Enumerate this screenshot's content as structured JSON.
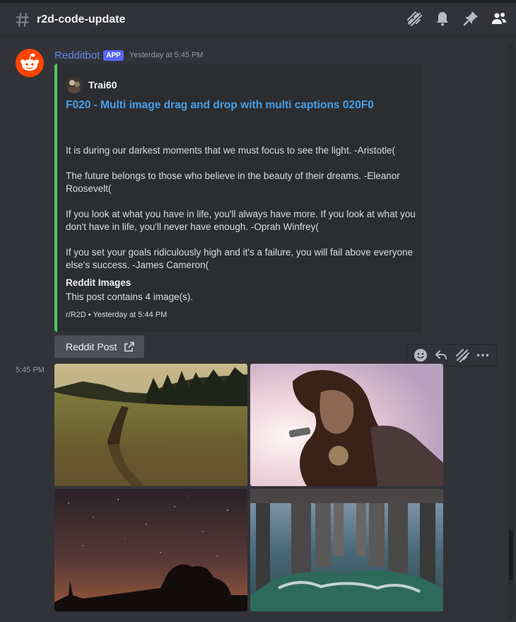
{
  "channel": {
    "name": "r2d-code-update"
  },
  "message": {
    "username": "Redditbot",
    "badge": "APP",
    "timestamp": "Yesterday at 5:45 PM",
    "short_time": "5:45 PM"
  },
  "embed": {
    "author": "Trai60",
    "title": "F020 - Multi image drag and drop with multi captions 020F0",
    "quotes": [
      "It is during our darkest moments that we must focus to see the light. -Aristotle(",
      "The future belongs to those who believe in the beauty of their dreams. -Eleanor Roosevelt(",
      "If you look at what you have in life, you'll always have more. If you look at what you don't have in life, you'll never have enough. -Oprah Winfrey(",
      "If you set your goals ridiculously high and it's a failure, you will fail above everyone else's success. -James Cameron("
    ],
    "field_name": "Reddit Images",
    "field_value": "This post contains 4 image(s).",
    "footer": "r/R2D • Yesterday at 5:44 PM",
    "accent_color": "#57c565"
  },
  "button": {
    "label": "Reddit Post"
  },
  "colors": {
    "link": "#4a9fe8",
    "username": "#5e8ce6",
    "badge": "#5865f2",
    "reddit": "#ff4500"
  }
}
